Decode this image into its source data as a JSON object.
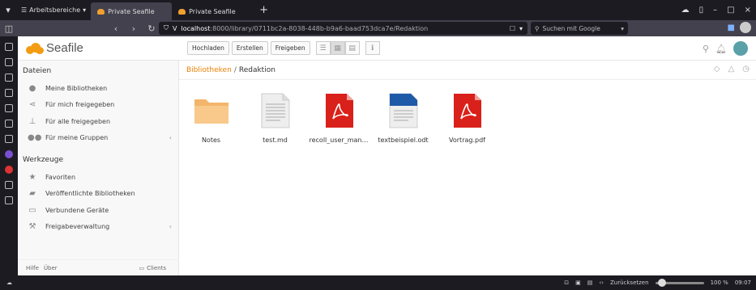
{
  "browser": {
    "workspaces_label": "Arbeitsbereiche",
    "tabs": [
      {
        "label": "Private Seafile"
      },
      {
        "label": "Private Seafile"
      }
    ],
    "url_host": "localhost",
    "url_path": ":8000/library/0711bc2a-8038-448b-b9a6-baad753dca7e/Redaktion",
    "search_placeholder": "Suchen mit Google",
    "status": {
      "reset_label": "Zurücksetzen",
      "zoom": "100 %",
      "time": "09:07"
    }
  },
  "app": {
    "logo_text": "Seafile",
    "toolbar": {
      "upload": "Hochladen",
      "create": "Erstellen",
      "share": "Freigeben"
    }
  },
  "sidebar": {
    "files_heading": "Dateien",
    "files_items": [
      {
        "label": "Meine Bibliotheken",
        "icon": "user-icon"
      },
      {
        "label": "Für mich freigegeben",
        "icon": "share-icon"
      },
      {
        "label": "Für alle freigegeben",
        "icon": "sitemap-icon"
      },
      {
        "label": "Für meine Gruppen",
        "icon": "group-icon"
      }
    ],
    "tools_heading": "Werkzeuge",
    "tools_items": [
      {
        "label": "Favoriten",
        "icon": "star-icon"
      },
      {
        "label": "Veröffentlichte Bibliotheken",
        "icon": "published-icon"
      },
      {
        "label": "Verbundene Geräte",
        "icon": "monitor-icon"
      },
      {
        "label": "Freigabeverwaltung",
        "icon": "wrench-icon"
      }
    ],
    "footer": {
      "help": "Hilfe",
      "about": "Über",
      "clients": "Clients"
    }
  },
  "main": {
    "breadcrumb": {
      "root": "Bibliotheken",
      "separator": "/",
      "current": "Redaktion"
    },
    "files": [
      {
        "name": "Notes",
        "type": "folder"
      },
      {
        "name": "test.md",
        "type": "text"
      },
      {
        "name": "recoll_user_manu...",
        "type": "pdf"
      },
      {
        "name": "textbeispiel.odt",
        "type": "odt"
      },
      {
        "name": "Vortrag.pdf",
        "type": "pdf"
      }
    ]
  }
}
